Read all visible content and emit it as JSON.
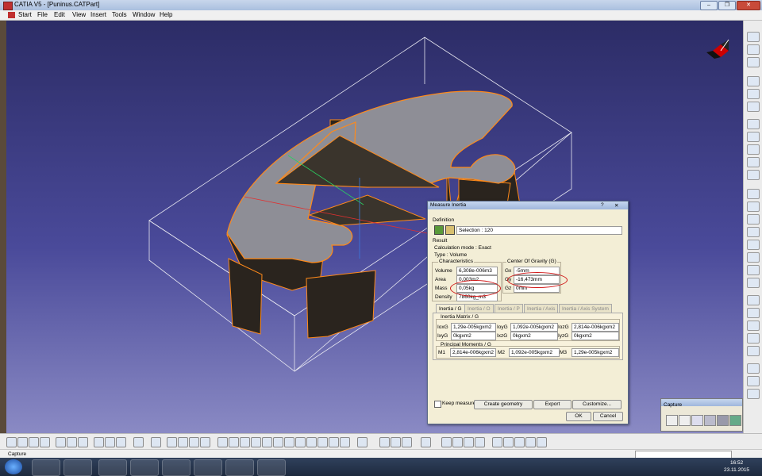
{
  "window": {
    "title": "CATIA V5 - [Puninus.CATPart]",
    "min": "–",
    "max": "❐",
    "close": "✕"
  },
  "menu": [
    "Start",
    "File",
    "Edit",
    "View",
    "Insert",
    "Tools",
    "Window",
    "Help"
  ],
  "dialog": {
    "title": "Measure Inertia",
    "help_btn": "?",
    "close_btn": "✕",
    "definition_label": "Definition",
    "selection_label": "Selection : 120",
    "result_label": "Result",
    "calc_mode": "Calculation mode : Exact",
    "type": "Type : Volume",
    "characteristics_label": "Characteristics",
    "volume_label": "Volume",
    "volume_value": "6,308e-006m3",
    "area_label": "Area",
    "area_value": "0,003m2",
    "mass_label": "Mass",
    "mass_value": "0,05kg",
    "density_label": "Density",
    "density_value": "7860kg_m3",
    "cog_label": "Center Of Gravity (G)",
    "gx_label": "Gx",
    "gx_value": "-5mm",
    "gy_label": "Gy",
    "gy_value": "-16,473mm",
    "gz_label": "Gz",
    "gz_value": "0mm",
    "tabs": [
      "Inertia / G",
      "Inertia / O",
      "Inertia / P",
      "Inertia / Axis",
      "Inertia / Axis System"
    ],
    "matrix_label": "Inertia Matrix / G",
    "matrix": [
      [
        "IoxG",
        "1,29e-005kgxm2",
        "IoyG",
        "1,092e-005kgxm2",
        "IozG",
        "2,814e-006kgxm2"
      ],
      [
        "IxyG",
        "0kgxm2",
        "IxzG",
        "0kgxm2",
        "IyzG",
        "0kgxm2"
      ]
    ],
    "principal_label": "Principal Moments / G",
    "principal": [
      "M1",
      "2,814e-006kgxm2",
      "M2",
      "1,092e-005kgxm2",
      "M3",
      "1,29e-005kgxm2"
    ],
    "keep_measure": "Keep measure",
    "create_geometry": "Create geometry",
    "export": "Export",
    "customize": "Customize...",
    "ok": "OK",
    "cancel": "Cancel"
  },
  "capture_toolbar": {
    "title": "Capture"
  },
  "status": {
    "text": "Capture"
  },
  "clock": {
    "time": "16:52",
    "date": "23.11.2015"
  },
  "colors": {
    "viewport_top": "#2c2c66",
    "edge_orange": "#ff8a1a",
    "highlight_red": "#d01818"
  }
}
